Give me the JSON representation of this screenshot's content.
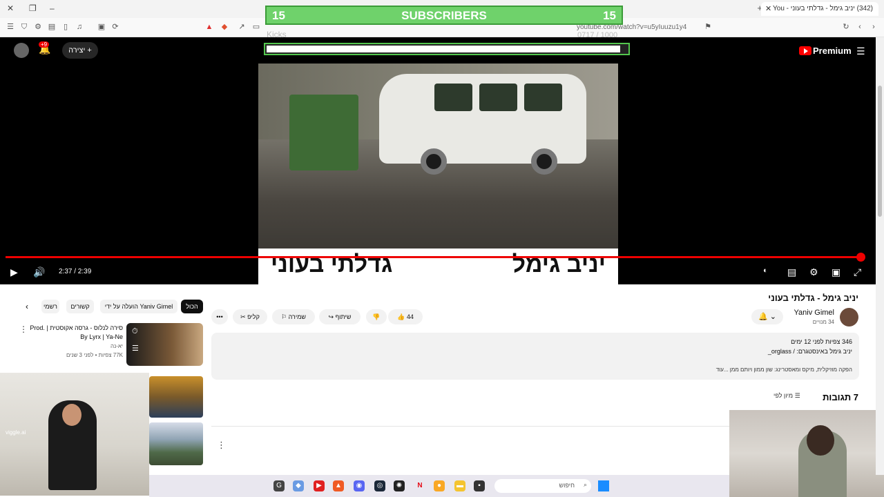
{
  "browser": {
    "tab_title": "(342) יניב גימל - גדלתי בעוני - You",
    "url": "youtube.com/watch?v=u5yIuuzu1y4"
  },
  "overlay": {
    "subs_left": "15",
    "subs_label": "SUBSCRIBERS",
    "subs_right": "15",
    "kicks_label": "Kicks",
    "kicks_count": "0717 / 1000",
    "kicks_progress": 0.98
  },
  "header": {
    "notif_badge": "+9",
    "create_label": "יצירה",
    "premium_label": "Premium"
  },
  "video": {
    "overlay_title_right": "יניב גימל",
    "overlay_title_left": "גדלתי בעוני",
    "time": "2:37 / 2:39",
    "progress": 0.99
  },
  "info": {
    "title": "יניב גימל - גדלתי בעוני",
    "channel_name": "Yaniv Gimel",
    "channel_subs": "34 מנויים",
    "likes": "44",
    "share_label": "שיתוף",
    "save_label": "שמירה",
    "clip_label": "קליפ",
    "desc_stats": "346 צפיות  לפני 12 ימים",
    "desc_links": "יניב גימל באינסטגרם:  / orglass_",
    "desc_credits": "הפקה מוזיקלית, מיקס ומאסטרינג: שון ממון ויותם ממן ...עוד",
    "comments_count": "7 תגובות",
    "sort_label": "מיון לפי"
  },
  "chips": {
    "all": "הכול",
    "by_channel": "הועלה על ידי Yaniv Gimel",
    "related": "קשורים",
    "recent": "רשמי"
  },
  "recommendation": {
    "title": "סירה לנלוס - גרסה אקוסטית | Prod. By Lyrx | Ya-Ne",
    "channel": "יא-נה",
    "meta": "77K צפיות • לפני 3 שנים"
  },
  "cam": {
    "watermark": "viggle.ai"
  },
  "taskbar": {
    "search_placeholder": "חיפוש"
  },
  "colors": {
    "youtube_red": "#ff0000",
    "subs_green": "#6fd26b"
  }
}
